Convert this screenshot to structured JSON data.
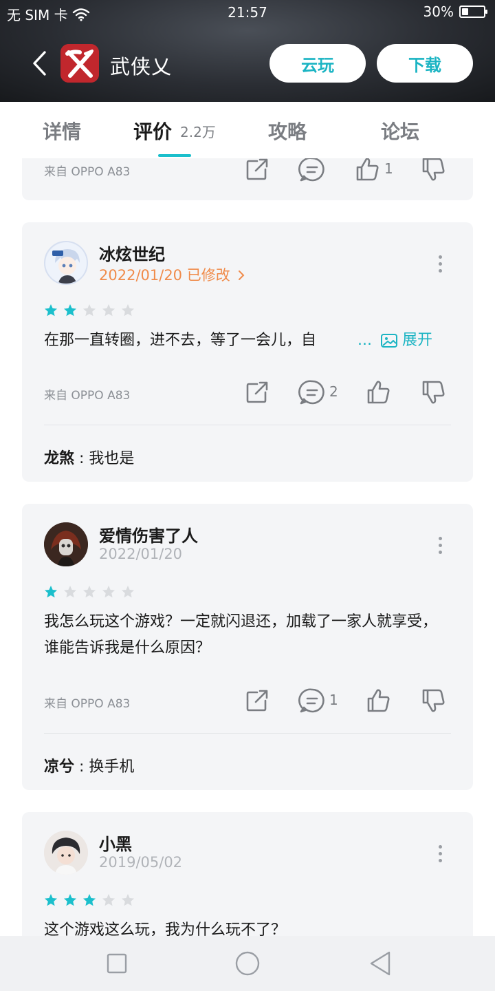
{
  "status_bar": {
    "carrier": "无 SIM 卡",
    "time": "21:57",
    "battery": "30%",
    "battery_level": 0.3
  },
  "app": {
    "title": "武侠乂",
    "cloud_play": "云玩",
    "download": "下载"
  },
  "tabs": [
    {
      "label": "详情"
    },
    {
      "label": "评价",
      "count": "2.2万"
    },
    {
      "label": "攻略"
    },
    {
      "label": "论坛"
    }
  ],
  "partial_card": {
    "device": "来自 OPPO A83",
    "likes": "1"
  },
  "reviews": [
    {
      "user": "冰炫世纪",
      "date": "2022/01/20 已修改",
      "rating": 2,
      "text": "在那一直转圈，进不去，等了一会儿，自",
      "ellipsis": "...",
      "expand": "展开",
      "device": "来自 OPPO A83",
      "comments": "2",
      "reply_user": "龙煞",
      "reply_text": " : 我也是"
    },
    {
      "user": "爱情伤害了人",
      "date": "2022/01/20",
      "rating": 1,
      "text": "我怎么玩这个游戏？一定就闪退还，加载了一家人就享受，谁能告诉我是什么原因？",
      "device": "来自 OPPO A83",
      "comments": "1",
      "reply_user": "凉兮",
      "reply_text": " : 换手机"
    },
    {
      "user": "小黑",
      "date": "2019/05/02",
      "rating": 3,
      "text": "这个游戏这么玩，我为什么玩不了？"
    }
  ],
  "colors": {
    "accent": "#1bb4c3",
    "edited_date": "#f08b4a",
    "star_on": "#1bbfcc",
    "star_off": "#d9dbde"
  }
}
